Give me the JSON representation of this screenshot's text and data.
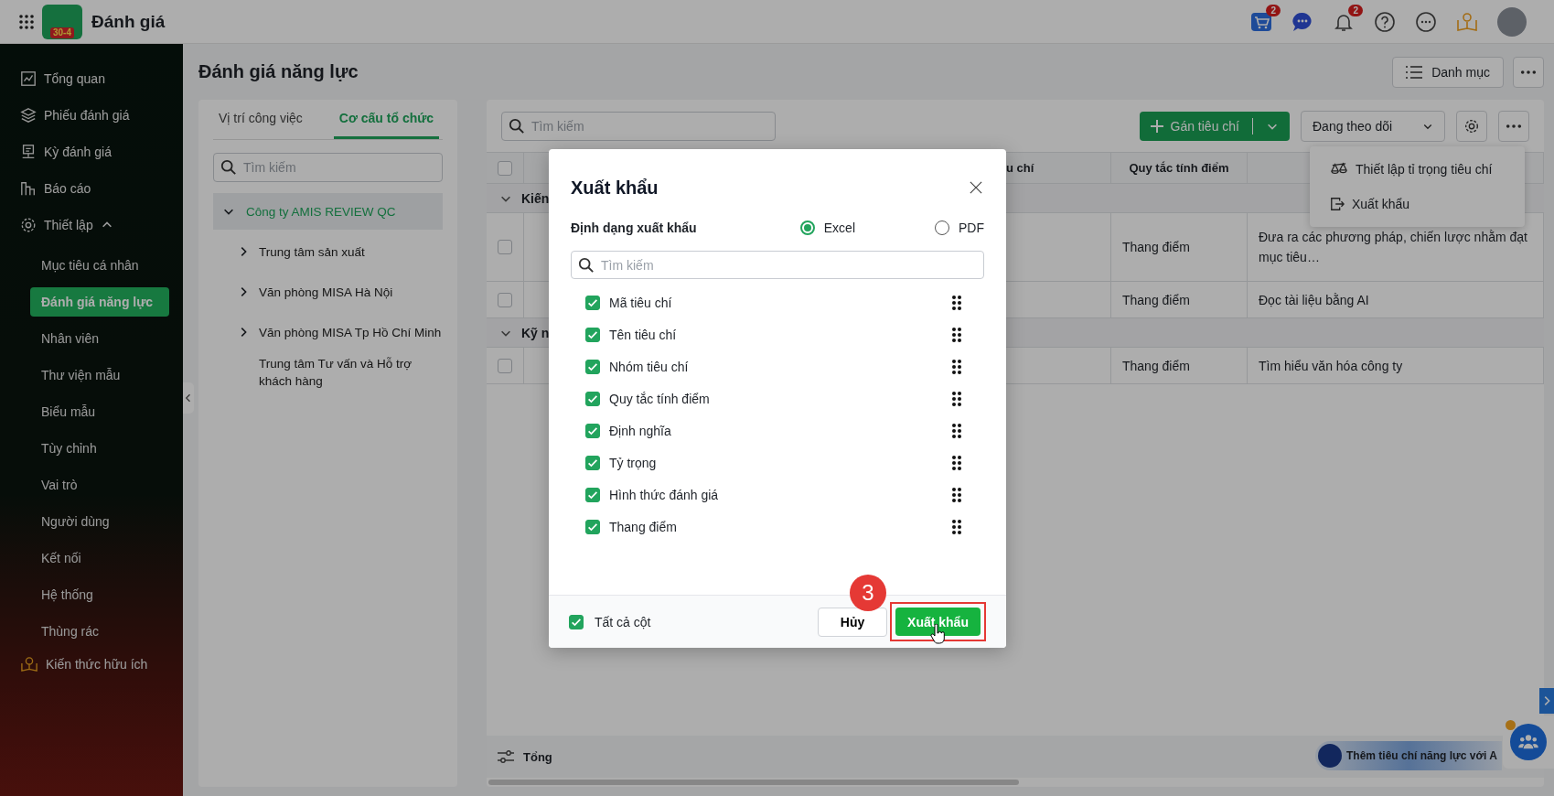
{
  "app": {
    "title": "Đánh giá",
    "logo_badge": "30-4"
  },
  "header_icons": [
    {
      "kind": "cart",
      "badge": "2"
    },
    {
      "kind": "chat"
    },
    {
      "kind": "bell",
      "badge": "2"
    },
    {
      "kind": "help"
    },
    {
      "kind": "more"
    },
    {
      "kind": "idea"
    },
    {
      "kind": "avatar"
    }
  ],
  "nav": [
    {
      "label": "Tổng quan",
      "kind": "chart",
      "selected": false
    },
    {
      "label": "Phiếu đánh giá",
      "kind": "layers",
      "selected": false
    },
    {
      "label": "Kỳ đánh giá",
      "kind": "period",
      "selected": false
    },
    {
      "label": "Báo cáo",
      "kind": "report",
      "selected": false
    },
    {
      "label": "Thiết lập",
      "kind": "settings",
      "selected": false,
      "expanded": true,
      "children": [
        {
          "label": "Mục tiêu cá nhân",
          "selected": false
        },
        {
          "label": "Đánh giá năng lực",
          "selected": true
        },
        {
          "label": "Nhân viên",
          "selected": false
        },
        {
          "label": "Thư viện mẫu",
          "selected": false
        },
        {
          "label": "Biểu mẫu",
          "selected": false
        },
        {
          "label": "Tùy chỉnh",
          "selected": false
        },
        {
          "label": "Vai trò",
          "selected": false
        },
        {
          "label": "Người dùng",
          "selected": false
        },
        {
          "label": "Kết nối",
          "selected": false
        },
        {
          "label": "Hệ thống",
          "selected": false
        },
        {
          "label": "Thùng rác",
          "selected": false
        }
      ]
    },
    {
      "label": "Kiến thức hữu ích",
      "kind": "idea",
      "selected": false
    }
  ],
  "page": {
    "title": "Đánh giá năng lực",
    "buttons": [
      {
        "label": "Danh mục",
        "kind": "list"
      },
      {
        "kind": "more"
      }
    ]
  },
  "left_panel": {
    "tabs": [
      {
        "label": "Vị trí công việc",
        "selected": false
      },
      {
        "label": "Cơ cấu tổ chức",
        "selected": true
      }
    ],
    "search": {
      "placeholder": "Tìm kiếm"
    },
    "tree": [
      {
        "label": "Công ty AMIS REVIEW QC",
        "kind": "branch",
        "expanded": true,
        "selected": true,
        "children": [
          {
            "label": "Trung tâm sản xuất",
            "kind": "branch",
            "expanded": false,
            "selected": false
          },
          {
            "label": "Văn phòng MISA Hà Nội",
            "kind": "branch",
            "expanded": false,
            "selected": false
          },
          {
            "label": "Văn phòng MISA Tp Hồ Chí Minh",
            "kind": "branch",
            "expanded": false,
            "selected": false
          },
          {
            "label": "Trung tâm Tư vấn và Hỗ trợ khách hàng",
            "kind": "leaf",
            "selected": false
          }
        ]
      }
    ]
  },
  "toolbar": {
    "search": {
      "placeholder": "Tìm kiếm"
    },
    "assign_button": "Gán tiêu chí",
    "filter": "Đang theo dõi"
  },
  "table": {
    "select_all": false,
    "columns": [
      "",
      "",
      "u chí",
      "Quy tắc tính điểm",
      ""
    ],
    "rows": [
      {
        "kind": "group",
        "label": "Kiến",
        "expanded": true
      },
      {
        "kind": "row",
        "checked": false,
        "scoring": "Thang điểm",
        "description": "Đưa ra các phương pháp, chiến lược nhằm đạt mục tiêu…"
      },
      {
        "kind": "row",
        "checked": false,
        "scoring": "Thang điểm",
        "description": "Đọc tài liệu bằng AI"
      },
      {
        "kind": "group",
        "label": "Kỹ n",
        "expanded": true
      },
      {
        "kind": "row",
        "checked": false,
        "scoring": "Thang điểm",
        "description": "Tìm hiểu văn hóa công ty"
      }
    ],
    "footer": "Tổng"
  },
  "more_menu": [
    {
      "label": "Thiết lập tỉ trọng tiêu chí",
      "kind": "balance"
    },
    {
      "label": "Xuất khẩu",
      "kind": "export"
    }
  ],
  "ai_chip": "Thêm tiêu chí năng lực với A",
  "dialog": {
    "title": "Xuất khẩu",
    "format_label": "Định dạng xuất khẩu",
    "formats": [
      {
        "label": "Excel",
        "selected": true
      },
      {
        "label": "PDF",
        "selected": false
      }
    ],
    "search": {
      "placeholder": "Tìm kiếm"
    },
    "fields": [
      {
        "label": "Mã tiêu chí",
        "checked": true
      },
      {
        "label": "Tên tiêu chí",
        "checked": true
      },
      {
        "label": "Nhóm tiêu chí",
        "checked": true
      },
      {
        "label": "Quy tắc tính điểm",
        "checked": true
      },
      {
        "label": "Định nghĩa",
        "checked": true
      },
      {
        "label": "Tỷ trọng",
        "checked": true
      },
      {
        "label": "Hình thức đánh giá",
        "checked": true
      },
      {
        "label": "Thang điểm",
        "checked": true
      }
    ],
    "all_columns": {
      "label": "Tất cả cột",
      "checked": true
    },
    "cancel": "Hủy",
    "export": "Xuất khẩu"
  },
  "annotation": {
    "step": "3"
  }
}
